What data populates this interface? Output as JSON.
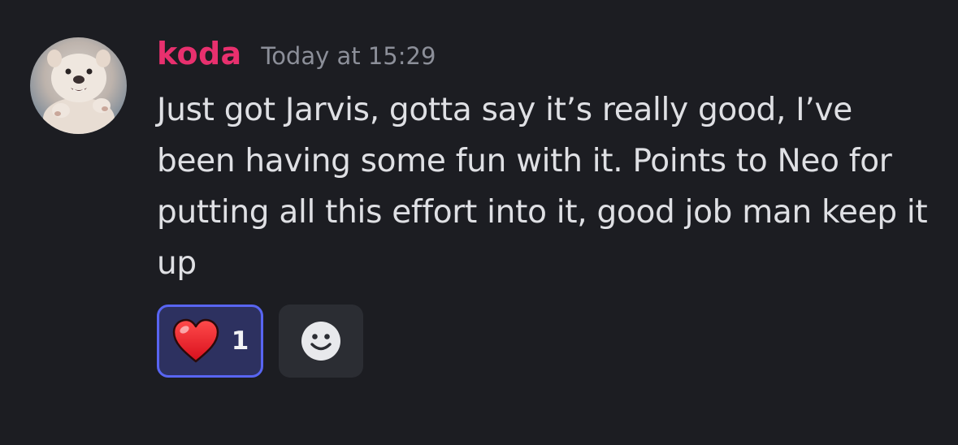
{
  "message": {
    "author": {
      "name": "koda",
      "name_color": "#e8306e",
      "avatar": "puppy-avatar"
    },
    "timestamp": "Today at 15:29",
    "content": "Just got Jarvis, gotta say it’s really good, I’ve been having some fun with it. Points to Neo for putting all this effort into it, good job man keep it up",
    "reactions": [
      {
        "emoji": "heart-icon",
        "count": "1",
        "active": true
      }
    ],
    "add_reaction": {
      "icon": "smiley-icon"
    }
  },
  "colors": {
    "background": "#1c1d22",
    "text": "#dfe0e4",
    "timestamp": "#8c8f99",
    "reaction_active_bg": "#2d3160",
    "reaction_active_border": "#5865f2",
    "add_reaction_bg": "#2b2d33"
  }
}
